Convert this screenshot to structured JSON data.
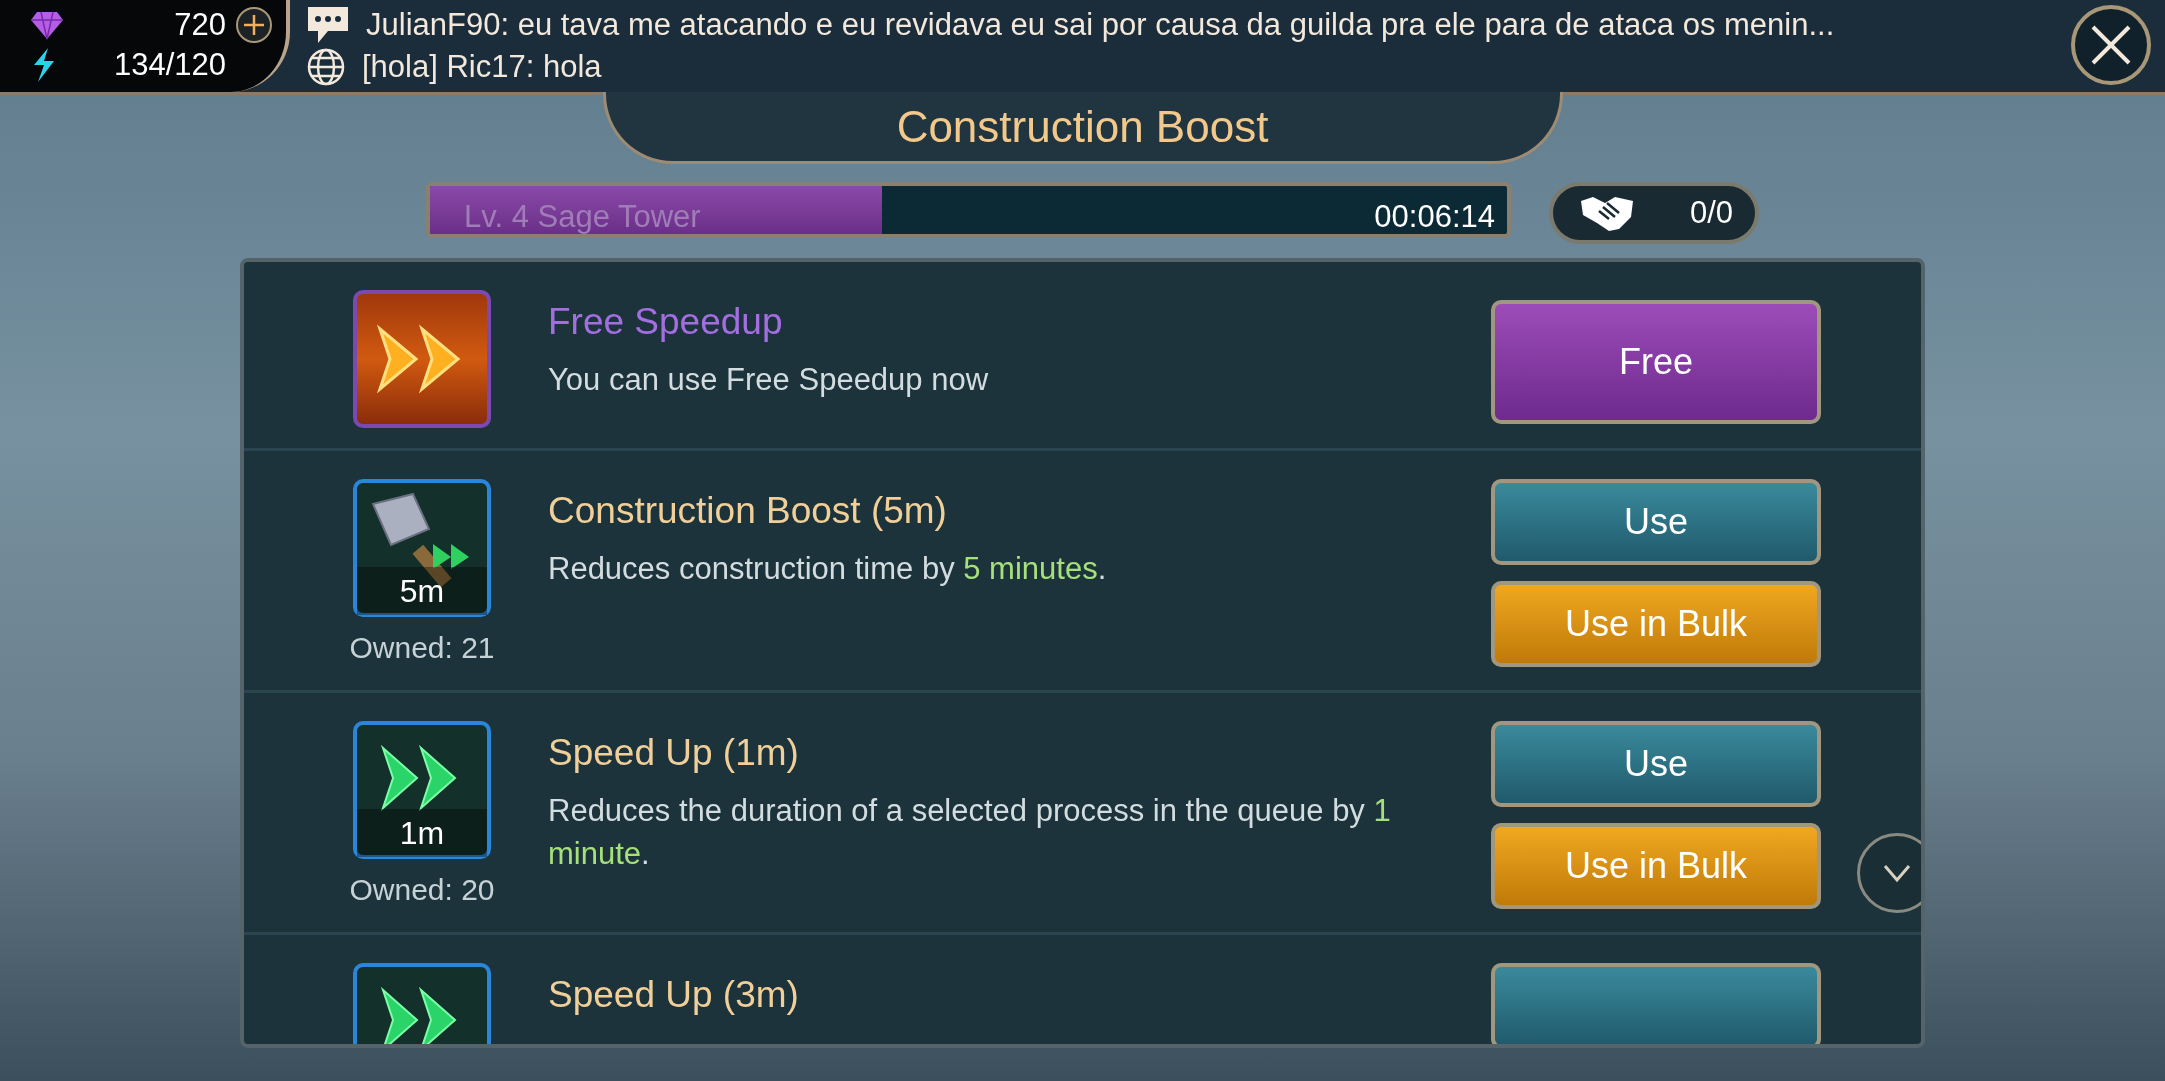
{
  "currencies": [
    {
      "kind": "gems",
      "value": "720",
      "addable": true
    },
    {
      "kind": "energy",
      "value": "134/120",
      "addable": false
    }
  ],
  "chat": [
    {
      "kind": "message",
      "text": "JulianF90: eu tava me atacando e eu revidava eu sai por causa da guilda pra ele para de ataca os menin..."
    },
    {
      "kind": "world",
      "text": "[hola] Ric17: hola"
    }
  ],
  "title": "Construction Boost",
  "queue": {
    "label": "Lv. 4 Sage Tower",
    "timer": "00:06:14",
    "level": 0.42
  },
  "help": {
    "count": "0/0"
  },
  "items": [
    {
      "kind": "free",
      "title": "Free Speedup",
      "description": [
        {
          "text": "You can use Free Speedup now",
          "highlight": false
        }
      ],
      "buttons": [
        {
          "kind": "free",
          "label": "Free"
        }
      ]
    },
    {
      "kind": "hammer",
      "badge": "5m",
      "title": "Construction Boost (5m)",
      "description": [
        {
          "text": "Reduces construction time by ",
          "highlight": false
        },
        {
          "text": "5 minutes",
          "highlight": true
        },
        {
          "text": ".",
          "highlight": false
        }
      ],
      "owned": "Owned: 21",
      "buttons": [
        {
          "kind": "use",
          "label": "Use"
        },
        {
          "kind": "bulk",
          "label": "Use in Bulk"
        }
      ]
    },
    {
      "kind": "speedup",
      "badge": "1m",
      "title": "Speed Up (1m)",
      "description": [
        {
          "text": "Reduces the duration of a selected process in the queue by ",
          "highlight": false
        },
        {
          "text": "1 minute",
          "highlight": true
        },
        {
          "text": ".",
          "highlight": false
        }
      ],
      "owned": "Owned: 20",
      "buttons": [
        {
          "kind": "use",
          "label": "Use"
        },
        {
          "kind": "bulk",
          "label": "Use in Bulk"
        }
      ],
      "side_button": true
    },
    {
      "kind": "speedup",
      "title": "Speed Up (3m)",
      "buttons": [
        {
          "kind": "use"
        }
      ]
    }
  ]
}
